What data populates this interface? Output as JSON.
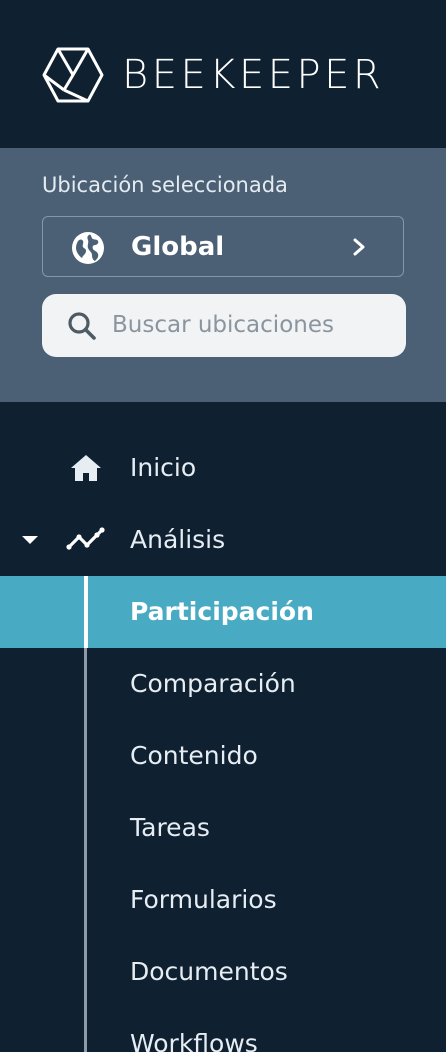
{
  "brand": {
    "name": "BEEKEEPER",
    "icon": "hexagon-cube-logo"
  },
  "location": {
    "label": "Ubicación seleccionada",
    "selected": "Global",
    "selected_icon": "globe-icon",
    "chevron_icon": "chevron-right-icon",
    "search_placeholder": "Buscar ubicaciones",
    "search_value": ""
  },
  "nav": {
    "items": [
      {
        "label": "Inicio",
        "icon": "home-icon"
      },
      {
        "label": "Análisis",
        "icon": "trend-line-icon",
        "expanded": true,
        "children": [
          {
            "label": "Participación",
            "active": true
          },
          {
            "label": "Comparación"
          },
          {
            "label": "Contenido"
          },
          {
            "label": "Tareas"
          },
          {
            "label": "Formularios"
          },
          {
            "label": "Documentos"
          },
          {
            "label": "Workflows"
          }
        ]
      }
    ]
  },
  "colors": {
    "sidebar_bg": "#0f2030",
    "panel_bg": "#4b6075",
    "active_bg": "#48abc3",
    "text": "#e6edf3"
  }
}
